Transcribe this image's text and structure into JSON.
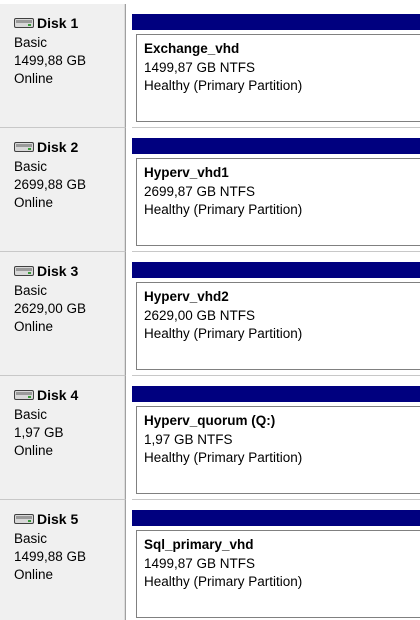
{
  "disks": [
    {
      "name": "Disk 1",
      "type": "Basic",
      "size": "1499,88 GB",
      "status": "Online",
      "volume": {
        "name": "Exchange_vhd",
        "size_fs": "1499,87 GB NTFS",
        "health": "Healthy (Primary Partition)"
      }
    },
    {
      "name": "Disk 2",
      "type": "Basic",
      "size": "2699,88 GB",
      "status": "Online",
      "volume": {
        "name": "Hyperv_vhd1",
        "size_fs": "2699,87 GB NTFS",
        "health": "Healthy (Primary Partition)"
      }
    },
    {
      "name": "Disk 3",
      "type": "Basic",
      "size": "2629,00 GB",
      "status": "Online",
      "volume": {
        "name": "Hyperv_vhd2",
        "size_fs": "2629,00 GB NTFS",
        "health": "Healthy (Primary Partition)"
      }
    },
    {
      "name": "Disk 4",
      "type": "Basic",
      "size": "1,97 GB",
      "status": "Online",
      "volume": {
        "name": "Hyperv_quorum  (Q:)",
        "size_fs": "1,97 GB NTFS",
        "health": "Healthy (Primary Partition)"
      }
    },
    {
      "name": "Disk 5",
      "type": "Basic",
      "size": "1499,88 GB",
      "status": "Online",
      "volume": {
        "name": "Sql_primary_vhd",
        "size_fs": "1499,87 GB NTFS",
        "health": "Healthy (Primary Partition)"
      }
    }
  ],
  "icons": {
    "disk": "hard-disk-icon"
  },
  "colors": {
    "partition_bar": "#00007f",
    "info_panel": "#f0f0f0"
  }
}
